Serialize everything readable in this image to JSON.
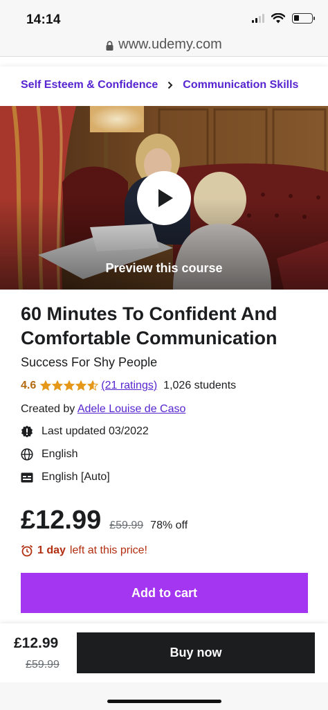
{
  "status": {
    "time": "14:14"
  },
  "browser": {
    "url": "www.udemy.com"
  },
  "breadcrumb": {
    "items": [
      "Self Esteem & Confidence",
      "Communication Skills"
    ]
  },
  "video": {
    "preview_label": "Preview this course"
  },
  "course": {
    "title": "60 Minutes To Confident And Comfortable Communication",
    "subtitle": "Success For Shy People",
    "rating": "4.6",
    "rating_stars": 4.6,
    "ratings_count": "(21 ratings)",
    "students": "1,026 students",
    "created_by_label": "Created by",
    "instructor": "Adele Louise de Caso",
    "last_updated": "Last updated 03/2022",
    "language": "English",
    "captions": "English [Auto]"
  },
  "pricing": {
    "current": "£12.99",
    "original": "£59.99",
    "discount": "78% off",
    "timer_bold": "1 day",
    "timer_rest": "left at this price!",
    "add_to_cart": "Add to cart"
  },
  "bottom_bar": {
    "price": "£12.99",
    "original": "£59.99",
    "buy_now": "Buy now"
  },
  "colors": {
    "brand_purple": "#a435f0",
    "link_purple": "#5624d0",
    "rating_orange": "#b4690e",
    "alert_red": "#b32d0f",
    "dark": "#1c1d1f"
  },
  "icons": [
    "lock-icon",
    "play-icon",
    "star-icon",
    "alert-badge-icon",
    "globe-icon",
    "captions-icon",
    "alarm-clock-icon",
    "chevron-right-icon",
    "wifi-icon",
    "signal-icon",
    "battery-icon"
  ]
}
